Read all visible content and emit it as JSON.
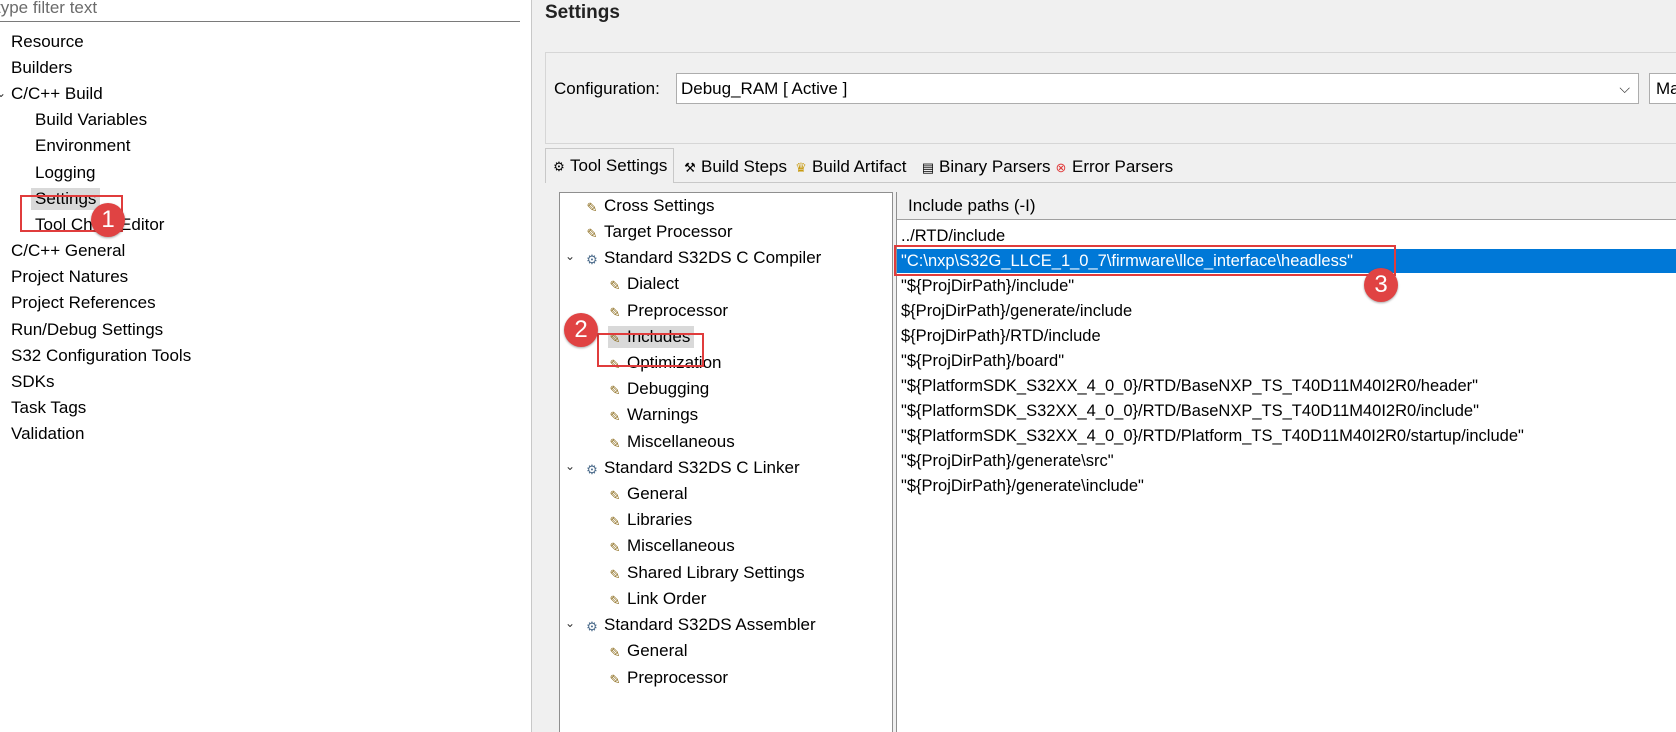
{
  "filter": {
    "placeholder": "type filter text"
  },
  "nav": {
    "items": [
      {
        "label": "Resource"
      },
      {
        "label": "Builders"
      },
      {
        "label": "C/C++ Build"
      },
      {
        "label": "Build Variables"
      },
      {
        "label": "Environment"
      },
      {
        "label": "Logging"
      },
      {
        "label": "Settings"
      },
      {
        "label": "Tool Chain Editor"
      },
      {
        "label": "C/C++ General"
      },
      {
        "label": "Project Natures"
      },
      {
        "label": "Project References"
      },
      {
        "label": "Run/Debug Settings"
      },
      {
        "label": "S32 Configuration Tools"
      },
      {
        "label": "SDKs"
      },
      {
        "label": "Task Tags"
      },
      {
        "label": "Validation"
      }
    ]
  },
  "settings": {
    "title": "Settings",
    "configuration_label": "Configuration:",
    "configuration_value": "Debug_RAM  [ Active ]",
    "manage_label": "Ma"
  },
  "tabs": [
    {
      "label": "Tool Settings",
      "icon": "gear-icon"
    },
    {
      "label": "Build Steps",
      "icon": "hammer-icon"
    },
    {
      "label": "Build Artifact",
      "icon": "trophy-icon"
    },
    {
      "label": "Binary Parsers",
      "icon": "binary-icon"
    },
    {
      "label": "Error Parsers",
      "icon": "error-icon"
    }
  ],
  "tree": {
    "items": [
      {
        "label": "Cross Settings"
      },
      {
        "label": "Target Processor"
      },
      {
        "label": "Standard S32DS C Compiler"
      },
      {
        "label": "Dialect"
      },
      {
        "label": "Preprocessor"
      },
      {
        "label": "Includes"
      },
      {
        "label": "Optimization"
      },
      {
        "label": "Debugging"
      },
      {
        "label": "Warnings"
      },
      {
        "label": "Miscellaneous"
      },
      {
        "label": "Standard S32DS C Linker"
      },
      {
        "label": "General"
      },
      {
        "label": "Libraries"
      },
      {
        "label": "Miscellaneous"
      },
      {
        "label": "Shared Library Settings"
      },
      {
        "label": "Link Order"
      },
      {
        "label": "Standard S32DS Assembler"
      },
      {
        "label": "General"
      },
      {
        "label": "Preprocessor"
      }
    ]
  },
  "include_paths": {
    "header": "Include paths (-I)",
    "rows": [
      "../RTD/include",
      "\"C:\\nxp\\S32G_LLCE_1_0_7\\firmware\\llce_interface\\headless\"",
      "\"${ProjDirPath}/include\"",
      "${ProjDirPath}/generate/include",
      "${ProjDirPath}/RTD/include",
      "\"${ProjDirPath}/board\"",
      "\"${PlatformSDK_S32XX_4_0_0}/RTD/BaseNXP_TS_T40D11M40I2R0/header\"",
      "\"${PlatformSDK_S32XX_4_0_0}/RTD/BaseNXP_TS_T40D11M40I2R0/include\"",
      "\"${PlatformSDK_S32XX_4_0_0}/RTD/Platform_TS_T40D11M40I2R0/startup/include\"",
      "\"${ProjDirPath}/generate\\src\"",
      "\"${ProjDirPath}/generate\\include\""
    ],
    "selected_index": 1
  },
  "annotations": {
    "step1": "1",
    "step2": "2",
    "step3": "3"
  },
  "colors": {
    "selection": "#0078d7",
    "annotation": "#e04343"
  }
}
